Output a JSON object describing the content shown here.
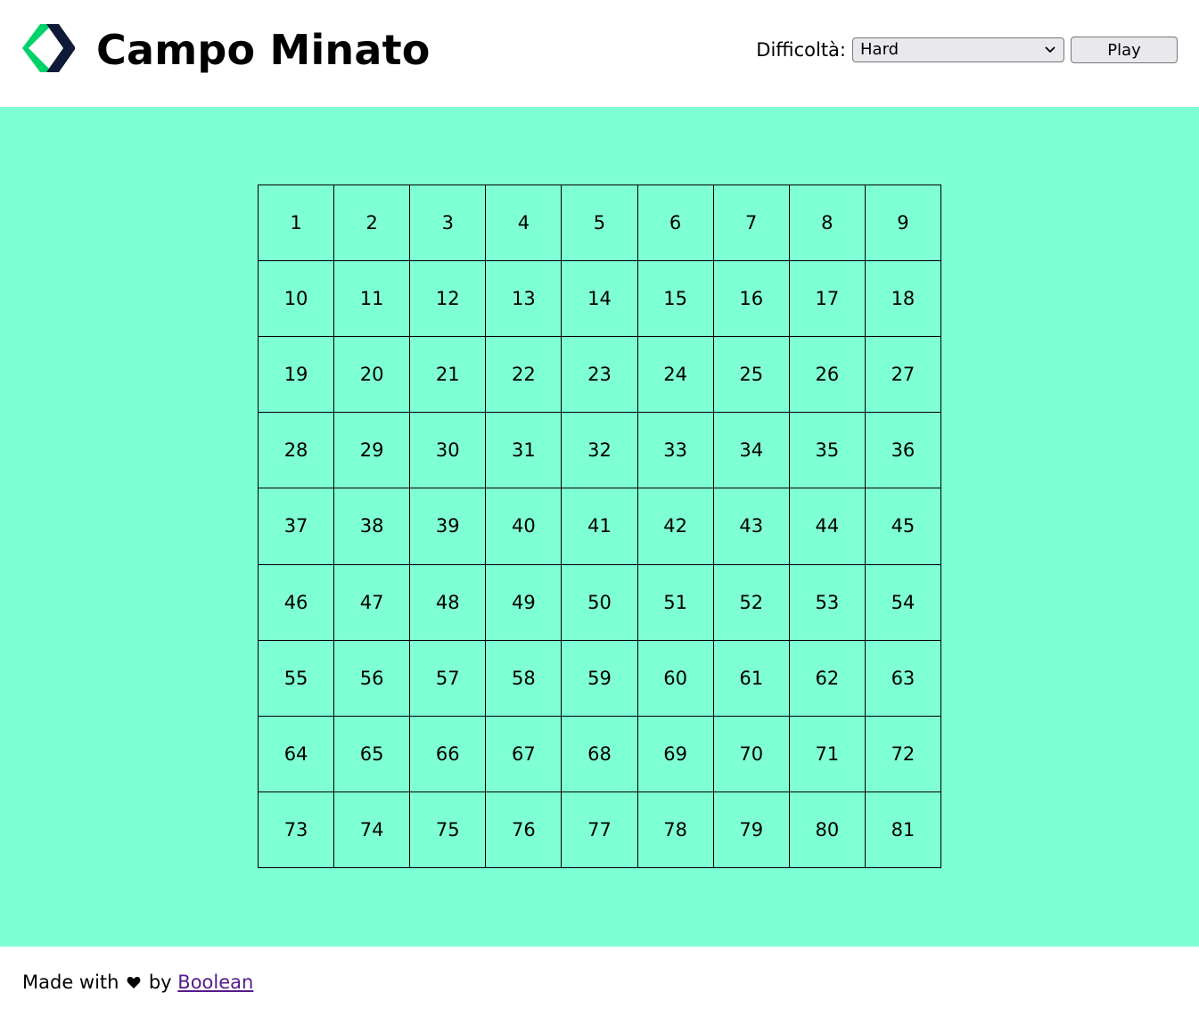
{
  "header": {
    "title": "Campo Minato",
    "logo_icon": "boolean-logo-icon",
    "difficulty_label": "Difficoltà:",
    "difficulty_selected": "Hard",
    "play_label": "Play"
  },
  "grid": {
    "columns": 9,
    "rows": 9,
    "cells": [
      "1",
      "2",
      "3",
      "4",
      "5",
      "6",
      "7",
      "8",
      "9",
      "10",
      "11",
      "12",
      "13",
      "14",
      "15",
      "16",
      "17",
      "18",
      "19",
      "20",
      "21",
      "22",
      "23",
      "24",
      "25",
      "26",
      "27",
      "28",
      "29",
      "30",
      "31",
      "32",
      "33",
      "34",
      "35",
      "36",
      "37",
      "38",
      "39",
      "40",
      "41",
      "42",
      "43",
      "44",
      "45",
      "46",
      "47",
      "48",
      "49",
      "50",
      "51",
      "52",
      "53",
      "54",
      "55",
      "56",
      "57",
      "58",
      "59",
      "60",
      "61",
      "62",
      "63",
      "64",
      "65",
      "66",
      "67",
      "68",
      "69",
      "70",
      "71",
      "72",
      "73",
      "74",
      "75",
      "76",
      "77",
      "78",
      "79",
      "80",
      "81"
    ]
  },
  "footer": {
    "made_with": "Made with",
    "heart_icon": "heart-icon",
    "by": "by",
    "link_text": "Boolean"
  },
  "colors": {
    "main_bg": "#7fffd4",
    "logo_green": "#00d26a",
    "logo_navy": "#0e1a36",
    "link": "#551a8b"
  }
}
